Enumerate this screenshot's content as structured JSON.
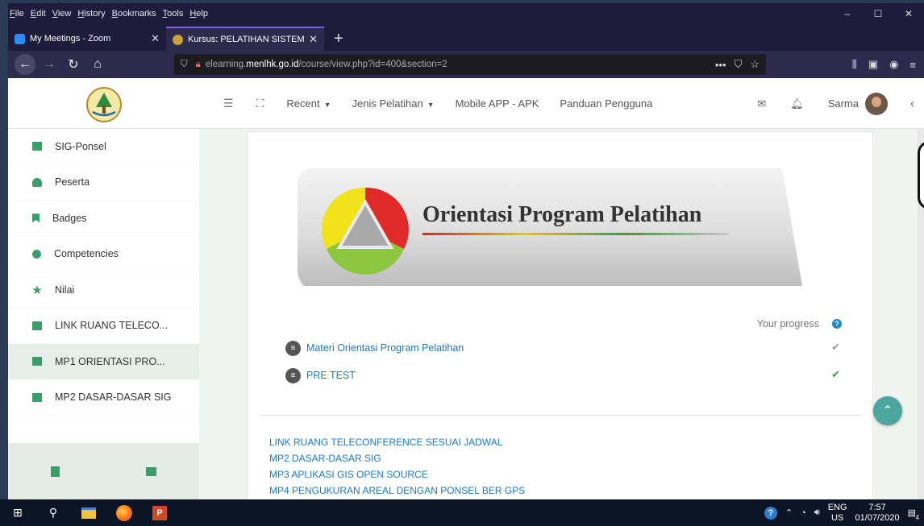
{
  "menubar": {
    "items": [
      "File",
      "Edit",
      "View",
      "History",
      "Bookmarks",
      "Tools",
      "Help"
    ]
  },
  "window_controls": {
    "minimize": "–",
    "maximize": "☐",
    "close": "✕"
  },
  "tabs": [
    {
      "title": "My Meetings - Zoom",
      "favicon_color": "#2d8cff",
      "active": false
    },
    {
      "title": "Kursus: PELATIHAN SISTEM INF",
      "favicon_color": "#c7a23a",
      "active": true
    }
  ],
  "new_tab_label": "+",
  "address_bar": {
    "prefix": "elearning.",
    "host": "menlhk.go.id",
    "path": "/course/view.php?id=400&section=2"
  },
  "site_nav": {
    "recent": "Recent",
    "jenis": "Jenis Pelatihan",
    "mobile": "Mobile APP - APK",
    "panduan": "Panduan Pengguna",
    "user": "Sarma"
  },
  "sidebar": {
    "items": [
      {
        "label": "SIG-Ponsel",
        "icon": "calendar-icon"
      },
      {
        "label": "Peserta",
        "icon": "users-icon"
      },
      {
        "label": "Badges",
        "icon": "bookmark-icon"
      },
      {
        "label": "Competencies",
        "icon": "check-circle-icon"
      },
      {
        "label": "Nilai",
        "icon": "star-icon"
      },
      {
        "label": "LINK RUANG TELECO...",
        "icon": "folder-icon"
      },
      {
        "label": "MP1 ORIENTASI PRO...",
        "icon": "folder-icon"
      },
      {
        "label": "MP2 DASAR-DASAR SIG",
        "icon": "folder-icon"
      }
    ]
  },
  "banner": {
    "title": "Orientasi Program Pelatihan"
  },
  "progress": {
    "label": "Your progress",
    "help": "?"
  },
  "activities": [
    {
      "label": "Materi Orientasi Program Pelatihan",
      "check_color": "#9a9a9a"
    },
    {
      "label": "PRE TEST",
      "check_color": "#3a9d3a"
    }
  ],
  "section_links": [
    "LINK RUANG TELECONFERENCE SESUAI JADWAL",
    "MP2 DASAR-DASAR SIG",
    "MP3 APLIKASI GIS OPEN SOURCE",
    "MP4 PENGUKURAN AREAL DENGAN PONSEL BER GPS"
  ],
  "taskbar": {
    "lang": "ENG",
    "region": "US",
    "time": "7:57",
    "date": "01/07/2020",
    "notif_count": "4"
  },
  "colors": {
    "accent": "#1a7ac4",
    "fab": "#4ba6a0",
    "sidebar_active": "#e6efe9"
  }
}
